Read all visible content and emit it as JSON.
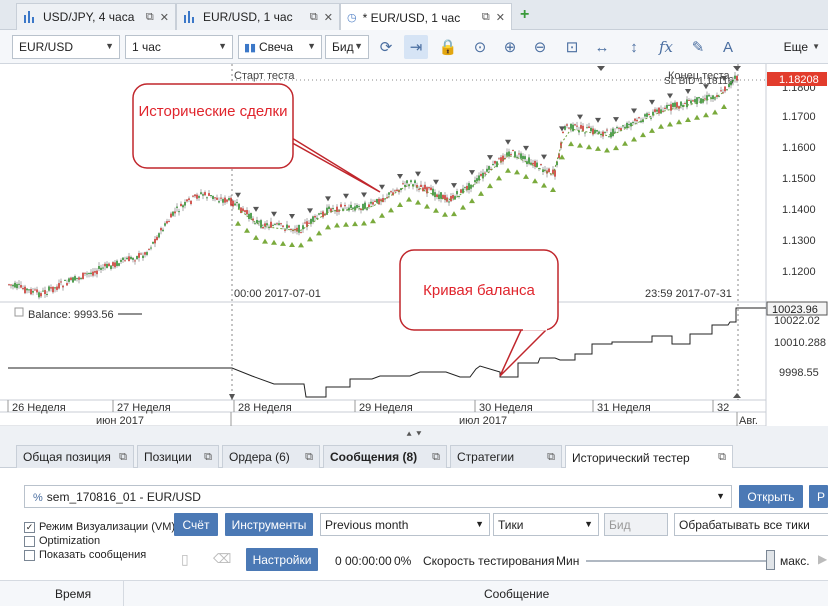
{
  "chart_tabs": [
    {
      "label": "USD/JPY, 4 часа",
      "active": false
    },
    {
      "label": "EUR/USD, 1 час",
      "active": false
    },
    {
      "label": "* EUR/USD, 1 час",
      "active": true
    }
  ],
  "toolbar": {
    "instrument": "EUR/USD",
    "period": "1 час",
    "chart_type": "Свеча",
    "price_type": "Бид",
    "more_label": "Еще"
  },
  "chart": {
    "start_test_label": "Старт теста",
    "end_test_label": "Конец теста",
    "sl_bid_label": "SL BID 1.18116",
    "current_price": "1.18208",
    "start_time": "00:00 2017-07-01",
    "end_time": "23:59 2017-07-31",
    "balance_legend": "Balance: 9993.56",
    "balance_current": "10023.96",
    "price_axis": [
      "1.1800",
      "1.1700",
      "1.1600",
      "1.1500",
      "1.1400",
      "1.1300",
      "1.1200"
    ],
    "balance_axis": [
      "10022.02",
      "10010.288",
      "9998.55"
    ],
    "weeks": [
      "26 Неделя",
      "27 Неделя",
      "28 Неделя",
      "29 Неделя",
      "30 Неделя",
      "31 Неделя",
      "32"
    ],
    "months": [
      "июн 2017",
      "июл 2017",
      "Авг."
    ],
    "callout_trades": "Исторические сделки",
    "callout_balance": "Кривая баланса",
    "colors": {
      "price_label_bg": "#e23c2c",
      "callout_border": "#c0262c",
      "callout_text": "#e0252d",
      "buy": "#7aaa3c",
      "sell": "#555555"
    }
  },
  "bottom_tabs": [
    {
      "label": "Общая позиция",
      "active": false
    },
    {
      "label": "Позиции",
      "active": false
    },
    {
      "label": "Ордера (6)",
      "active": false
    },
    {
      "label": "Сообщения (8)",
      "active": false
    },
    {
      "label": "Стратегии",
      "active": false
    },
    {
      "label": "Исторический тестер",
      "active": true
    }
  ],
  "tester": {
    "strategy": "sem_170816_01  -  EUR/USD",
    "open_button": "Открыть",
    "extra_button": "Р",
    "visual_mode": "Режим Визуализации (VM)",
    "visual_mode_checked": true,
    "optimization": "Optimization",
    "show_messages": "Показать сообщения",
    "report_button": "Счёт",
    "instruments_button": "Инструменты",
    "period": "Previous month",
    "data_type": "Тики",
    "price_placeholder": "Бид",
    "process_mode": "Обрабатывать все тики",
    "settings_button": "Настройки",
    "elapsed": "0 00:00:00",
    "progress": "0%",
    "speed_label": "Скорость тестирования",
    "speed_min": "Мин",
    "speed_max": "макс.",
    "speed_level": 1.0,
    "col_time": "Время",
    "col_message": "Сообщение"
  }
}
